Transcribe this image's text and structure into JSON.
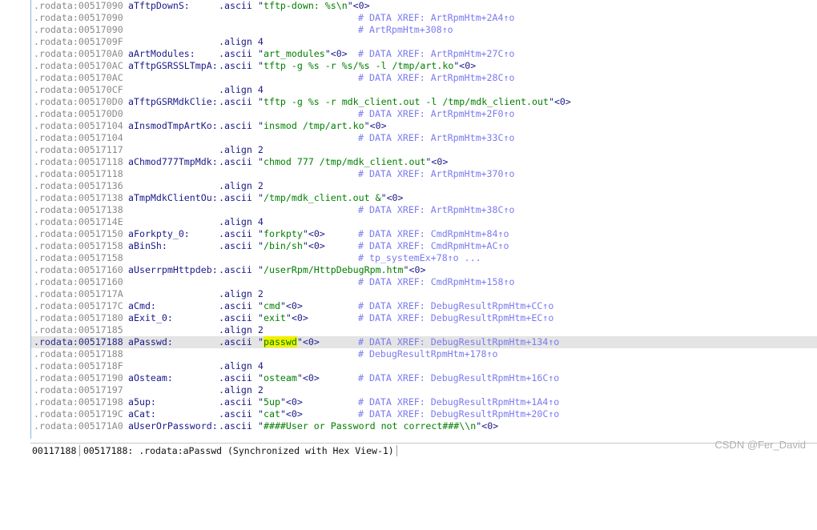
{
  "lines": [
    {
      "addr": ".rodata:00517090",
      "label": "aTftpDownS:",
      "directive": ".ascii",
      "value": {
        "quoted": "tftp-down: %s\\n",
        "suffix": "<0>"
      },
      "comment": ""
    },
    {
      "addr": ".rodata:00517090",
      "label": "",
      "directive": "",
      "value": null,
      "comment": "# DATA XREF: ArtRpmHtm+2A4↑o"
    },
    {
      "addr": ".rodata:00517090",
      "label": "",
      "directive": "",
      "value": null,
      "comment": "# ArtRpmHtm+308↑o"
    },
    {
      "addr": ".rodata:0051709F",
      "label": "",
      "directive": ".align 4",
      "value": null,
      "comment": ""
    },
    {
      "addr": ".rodata:005170A0",
      "label": "aArtModules:",
      "directive": ".ascii",
      "value": {
        "quoted": "art_modules",
        "suffix": "<0>"
      },
      "comment": "# DATA XREF: ArtRpmHtm+27C↑o"
    },
    {
      "addr": ".rodata:005170AC",
      "label": "aTftpGSRSSLTmpA:",
      "directive": ".ascii",
      "value": {
        "quoted": "tftp -g %s -r %s/%s -l /tmp/art.ko",
        "suffix": "<0>"
      },
      "comment": ""
    },
    {
      "addr": ".rodata:005170AC",
      "label": "",
      "directive": "",
      "value": null,
      "comment": "# DATA XREF: ArtRpmHtm+28C↑o"
    },
    {
      "addr": ".rodata:005170CF",
      "label": "",
      "directive": ".align 4",
      "value": null,
      "comment": ""
    },
    {
      "addr": ".rodata:005170D0",
      "label": "aTftpGSRMdkClie:",
      "directive": ".ascii",
      "value": {
        "quoted": "tftp -g %s -r mdk_client.out -l /tmp/mdk_client.out",
        "suffix": "<0>"
      },
      "comment": ""
    },
    {
      "addr": ".rodata:005170D0",
      "label": "",
      "directive": "",
      "value": null,
      "comment": "# DATA XREF: ArtRpmHtm+2F0↑o"
    },
    {
      "addr": ".rodata:00517104",
      "label": "aInsmodTmpArtKo:",
      "directive": ".ascii",
      "value": {
        "quoted": "insmod /tmp/art.ko",
        "suffix": "<0>"
      },
      "comment": ""
    },
    {
      "addr": ".rodata:00517104",
      "label": "",
      "directive": "",
      "value": null,
      "comment": "# DATA XREF: ArtRpmHtm+33C↑o"
    },
    {
      "addr": ".rodata:00517117",
      "label": "",
      "directive": ".align 2",
      "value": null,
      "comment": ""
    },
    {
      "addr": ".rodata:00517118",
      "label": "aChmod777TmpMdk:",
      "directive": ".ascii",
      "value": {
        "quoted": "chmod 777 /tmp/mdk_client.out",
        "suffix": "<0>"
      },
      "comment": ""
    },
    {
      "addr": ".rodata:00517118",
      "label": "",
      "directive": "",
      "value": null,
      "comment": "# DATA XREF: ArtRpmHtm+370↑o"
    },
    {
      "addr": ".rodata:00517136",
      "label": "",
      "directive": ".align 2",
      "value": null,
      "comment": ""
    },
    {
      "addr": ".rodata:00517138",
      "label": "aTmpMdkClientOu:",
      "directive": ".ascii",
      "value": {
        "quoted": "/tmp/mdk_client.out &",
        "suffix": "<0>"
      },
      "comment": ""
    },
    {
      "addr": ".rodata:00517138",
      "label": "",
      "directive": "",
      "value": null,
      "comment": "# DATA XREF: ArtRpmHtm+38C↑o"
    },
    {
      "addr": ".rodata:0051714E",
      "label": "",
      "directive": ".align 4",
      "value": null,
      "comment": ""
    },
    {
      "addr": ".rodata:00517150",
      "label": "aForkpty_0:",
      "directive": ".ascii",
      "value": {
        "quoted": "forkpty",
        "suffix": "<0>"
      },
      "comment": "# DATA XREF: CmdRpmHtm+84↑o"
    },
    {
      "addr": ".rodata:00517158",
      "label": "aBinSh:",
      "directive": ".ascii",
      "value": {
        "quoted": "/bin/sh",
        "suffix": "<0>"
      },
      "comment": "# DATA XREF: CmdRpmHtm+AC↑o"
    },
    {
      "addr": ".rodata:00517158",
      "label": "",
      "directive": "",
      "value": null,
      "comment": "# tp_systemEx+78↑o ..."
    },
    {
      "addr": ".rodata:00517160",
      "label": "aUserrpmHttpdeb:",
      "directive": ".ascii",
      "value": {
        "quoted": "/userRpm/HttpDebugRpm.htm",
        "suffix": "<0>"
      },
      "comment": ""
    },
    {
      "addr": ".rodata:00517160",
      "label": "",
      "directive": "",
      "value": null,
      "comment": "# DATA XREF: CmdRpmHtm+158↑o"
    },
    {
      "addr": ".rodata:0051717A",
      "label": "",
      "directive": ".align 2",
      "value": null,
      "comment": ""
    },
    {
      "addr": ".rodata:0051717C",
      "label": "aCmd:",
      "directive": ".ascii",
      "value": {
        "quoted": "cmd",
        "suffix": "<0>"
      },
      "comment": "# DATA XREF: DebugResultRpmHtm+CC↑o"
    },
    {
      "addr": ".rodata:00517180",
      "label": "aExit_0:",
      "directive": ".ascii",
      "value": {
        "quoted": "exit",
        "suffix": "<0>"
      },
      "comment": "# DATA XREF: DebugResultRpmHtm+EC↑o"
    },
    {
      "addr": ".rodata:00517185",
      "label": "",
      "directive": ".align 2",
      "value": null,
      "comment": ""
    },
    {
      "addr": ".rodata:00517188",
      "label": "aPasswd:",
      "directive": ".ascii",
      "value": {
        "quoted": "passwd",
        "suffix": "<0>",
        "highlight": true
      },
      "comment": "# DATA XREF: DebugResultRpmHtm+134↑o",
      "current": true
    },
    {
      "addr": ".rodata:00517188",
      "label": "",
      "directive": "",
      "value": null,
      "comment": "# DebugResultRpmHtm+178↑o"
    },
    {
      "addr": ".rodata:0051718F",
      "label": "",
      "directive": ".align 4",
      "value": null,
      "comment": ""
    },
    {
      "addr": ".rodata:00517190",
      "label": "aOsteam:",
      "directive": ".ascii",
      "value": {
        "quoted": "osteam",
        "suffix": "<0>"
      },
      "comment": "# DATA XREF: DebugResultRpmHtm+16C↑o"
    },
    {
      "addr": ".rodata:00517197",
      "label": "",
      "directive": ".align 2",
      "value": null,
      "comment": ""
    },
    {
      "addr": ".rodata:00517198",
      "label": "a5up:",
      "directive": ".ascii",
      "value": {
        "quoted": "5up",
        "suffix": "<0>"
      },
      "comment": "# DATA XREF: DebugResultRpmHtm+1A4↑o"
    },
    {
      "addr": ".rodata:0051719C",
      "label": "aCat:",
      "directive": ".ascii",
      "value": {
        "quoted": "cat",
        "suffix": "<0>"
      },
      "comment": "# DATA XREF: DebugResultRpmHtm+20C↑o"
    },
    {
      "addr": ".rodata:005171A0",
      "label": "aUserOrPassword:",
      "directive": ".ascii",
      "value": {
        "quoted": "####User or Password not correct###\\\\n",
        "suffix": "<0>"
      },
      "comment": ""
    }
  ],
  "statusbar": {
    "offset": "00117188",
    "location": "00517188: .rodata:aPasswd (Synchronized with Hex View-1)"
  },
  "watermark": "CSDN @Fer_David",
  "colors": {
    "address": "#8a8a8a",
    "keyword": "#1a1a8a",
    "string": "#007f00",
    "comment": "#7a7af0",
    "highlight": "#f0f000",
    "current_line": "#e4e4e4",
    "bullet": "#2c9fd6"
  },
  "icons": {
    "line_marker": "blue-dot-icon"
  }
}
